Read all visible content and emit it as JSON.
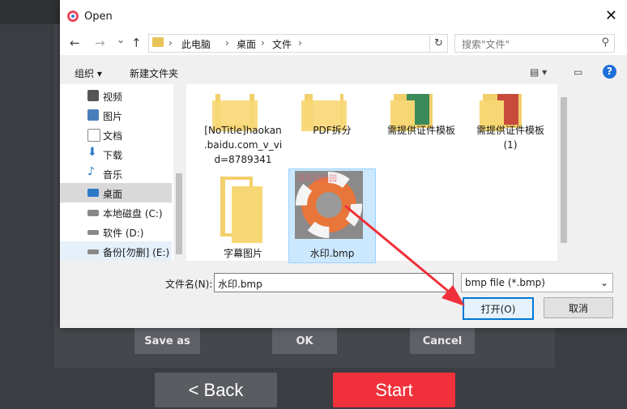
{
  "dialog": {
    "title": "Open",
    "close": "✕",
    "nav": {
      "back": "←",
      "forward": "→",
      "recent": "⌄",
      "up": "↑"
    },
    "breadcrumb": [
      "此电脑",
      "桌面",
      "文件"
    ],
    "breadcrumb_sep": "›",
    "refresh": "↻",
    "search_placeholder": "搜索\"文件\"",
    "toolbar": {
      "organize": "组织 ▾",
      "new_folder": "新建文件夹",
      "view": "▤ ▾",
      "pane": "▭",
      "help": "?"
    },
    "sidebar": [
      {
        "label": "视频",
        "color": "#555"
      },
      {
        "label": "图片",
        "color": "#4a7ebb"
      },
      {
        "label": "文档",
        "color": "#8a8a8a"
      },
      {
        "label": "下载",
        "color": "#2b78c5"
      },
      {
        "label": "音乐",
        "color": "#2b78c5"
      },
      {
        "label": "桌面",
        "color": "#2b78c5"
      },
      {
        "label": "本地磁盘 (C:)",
        "color": "#666"
      },
      {
        "label": "软件 (D:)",
        "color": "#666"
      },
      {
        "label": "备份[勿删] (E:)",
        "color": "#666"
      }
    ],
    "files": [
      {
        "label": "[NoTitle]haokan\n.baidu.com_v_vi\nd=8789341"
      },
      {
        "label": "PDF拆分"
      },
      {
        "label": "需提供证件模板"
      },
      {
        "label": "需提供证件模板\n(1)"
      },
      {
        "label": "字幕图片"
      },
      {
        "label": "水印.bmp",
        "watermark": "河东软件园"
      }
    ],
    "filename_label": "文件名(N):",
    "filename_value": "水印.bmp",
    "filetype_value": "bmp file (*.bmp)",
    "dropdown_caret": "⌄",
    "open_button": "打开(O)",
    "cancel_button": "取消"
  },
  "app": {
    "save_as": "Save as",
    "ok": "OK",
    "cancel": "Cancel",
    "back": "<  Back",
    "start": "Start"
  }
}
